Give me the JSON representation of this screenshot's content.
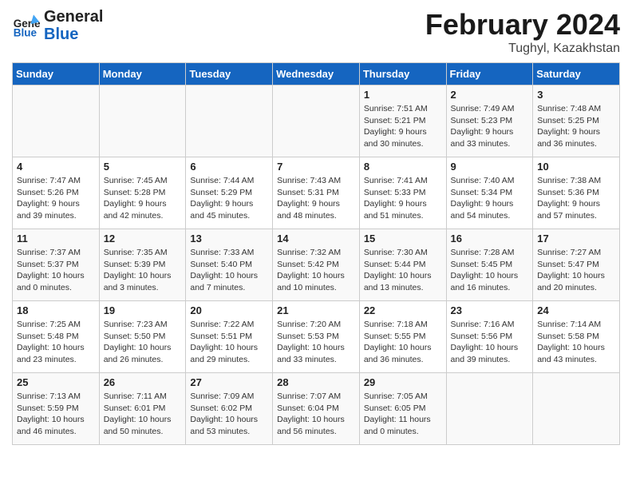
{
  "header": {
    "logo_general": "General",
    "logo_blue": "Blue",
    "month": "February 2024",
    "location": "Tughyl, Kazakhstan"
  },
  "weekdays": [
    "Sunday",
    "Monday",
    "Tuesday",
    "Wednesday",
    "Thursday",
    "Friday",
    "Saturday"
  ],
  "weeks": [
    [
      {
        "day": "",
        "info": ""
      },
      {
        "day": "",
        "info": ""
      },
      {
        "day": "",
        "info": ""
      },
      {
        "day": "",
        "info": ""
      },
      {
        "day": "1",
        "info": "Sunrise: 7:51 AM\nSunset: 5:21 PM\nDaylight: 9 hours and 30 minutes."
      },
      {
        "day": "2",
        "info": "Sunrise: 7:49 AM\nSunset: 5:23 PM\nDaylight: 9 hours and 33 minutes."
      },
      {
        "day": "3",
        "info": "Sunrise: 7:48 AM\nSunset: 5:25 PM\nDaylight: 9 hours and 36 minutes."
      }
    ],
    [
      {
        "day": "4",
        "info": "Sunrise: 7:47 AM\nSunset: 5:26 PM\nDaylight: 9 hours and 39 minutes."
      },
      {
        "day": "5",
        "info": "Sunrise: 7:45 AM\nSunset: 5:28 PM\nDaylight: 9 hours and 42 minutes."
      },
      {
        "day": "6",
        "info": "Sunrise: 7:44 AM\nSunset: 5:29 PM\nDaylight: 9 hours and 45 minutes."
      },
      {
        "day": "7",
        "info": "Sunrise: 7:43 AM\nSunset: 5:31 PM\nDaylight: 9 hours and 48 minutes."
      },
      {
        "day": "8",
        "info": "Sunrise: 7:41 AM\nSunset: 5:33 PM\nDaylight: 9 hours and 51 minutes."
      },
      {
        "day": "9",
        "info": "Sunrise: 7:40 AM\nSunset: 5:34 PM\nDaylight: 9 hours and 54 minutes."
      },
      {
        "day": "10",
        "info": "Sunrise: 7:38 AM\nSunset: 5:36 PM\nDaylight: 9 hours and 57 minutes."
      }
    ],
    [
      {
        "day": "11",
        "info": "Sunrise: 7:37 AM\nSunset: 5:37 PM\nDaylight: 10 hours and 0 minutes."
      },
      {
        "day": "12",
        "info": "Sunrise: 7:35 AM\nSunset: 5:39 PM\nDaylight: 10 hours and 3 minutes."
      },
      {
        "day": "13",
        "info": "Sunrise: 7:33 AM\nSunset: 5:40 PM\nDaylight: 10 hours and 7 minutes."
      },
      {
        "day": "14",
        "info": "Sunrise: 7:32 AM\nSunset: 5:42 PM\nDaylight: 10 hours and 10 minutes."
      },
      {
        "day": "15",
        "info": "Sunrise: 7:30 AM\nSunset: 5:44 PM\nDaylight: 10 hours and 13 minutes."
      },
      {
        "day": "16",
        "info": "Sunrise: 7:28 AM\nSunset: 5:45 PM\nDaylight: 10 hours and 16 minutes."
      },
      {
        "day": "17",
        "info": "Sunrise: 7:27 AM\nSunset: 5:47 PM\nDaylight: 10 hours and 20 minutes."
      }
    ],
    [
      {
        "day": "18",
        "info": "Sunrise: 7:25 AM\nSunset: 5:48 PM\nDaylight: 10 hours and 23 minutes."
      },
      {
        "day": "19",
        "info": "Sunrise: 7:23 AM\nSunset: 5:50 PM\nDaylight: 10 hours and 26 minutes."
      },
      {
        "day": "20",
        "info": "Sunrise: 7:22 AM\nSunset: 5:51 PM\nDaylight: 10 hours and 29 minutes."
      },
      {
        "day": "21",
        "info": "Sunrise: 7:20 AM\nSunset: 5:53 PM\nDaylight: 10 hours and 33 minutes."
      },
      {
        "day": "22",
        "info": "Sunrise: 7:18 AM\nSunset: 5:55 PM\nDaylight: 10 hours and 36 minutes."
      },
      {
        "day": "23",
        "info": "Sunrise: 7:16 AM\nSunset: 5:56 PM\nDaylight: 10 hours and 39 minutes."
      },
      {
        "day": "24",
        "info": "Sunrise: 7:14 AM\nSunset: 5:58 PM\nDaylight: 10 hours and 43 minutes."
      }
    ],
    [
      {
        "day": "25",
        "info": "Sunrise: 7:13 AM\nSunset: 5:59 PM\nDaylight: 10 hours and 46 minutes."
      },
      {
        "day": "26",
        "info": "Sunrise: 7:11 AM\nSunset: 6:01 PM\nDaylight: 10 hours and 50 minutes."
      },
      {
        "day": "27",
        "info": "Sunrise: 7:09 AM\nSunset: 6:02 PM\nDaylight: 10 hours and 53 minutes."
      },
      {
        "day": "28",
        "info": "Sunrise: 7:07 AM\nSunset: 6:04 PM\nDaylight: 10 hours and 56 minutes."
      },
      {
        "day": "29",
        "info": "Sunrise: 7:05 AM\nSunset: 6:05 PM\nDaylight: 11 hours and 0 minutes."
      },
      {
        "day": "",
        "info": ""
      },
      {
        "day": "",
        "info": ""
      }
    ]
  ]
}
